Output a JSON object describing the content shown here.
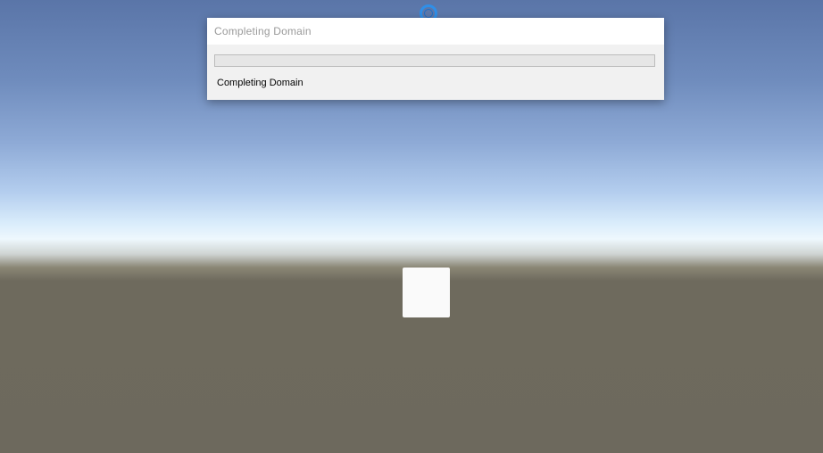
{
  "dialog": {
    "title": "Completing Domain",
    "status": "Completing Domain",
    "progress": 0
  },
  "icons": {
    "busy": "loading-spinner-icon"
  },
  "colors": {
    "spinner": "#2f8fe8",
    "progress_fill": "#06b025"
  }
}
